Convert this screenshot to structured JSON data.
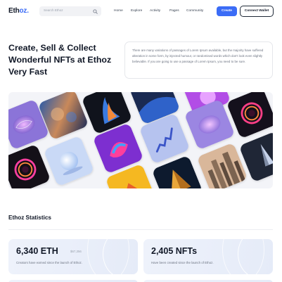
{
  "brand": {
    "name_main": "Eth",
    "name_accent": "oz."
  },
  "header": {
    "search_placeholder": "Search Ethoz",
    "nav": [
      "Home",
      "Explore",
      "Activity",
      "Pages",
      "Community"
    ],
    "create_label": "Create",
    "wallet_label": "Connect Wallet"
  },
  "hero": {
    "title": "Create, Sell & Collect Wonderful NFTs at Ethoz Very Fast",
    "description": "There are many variations of passages of Lorem Ipsum available, but the majority have suffered alteration in some form, by injected humour, or randomised words which don't look even slightly believable. If you are going to use a passage of Lorem Ipsum, you need to be sure."
  },
  "gallery": {
    "items": [
      "neon-ring",
      "cosmic-cloud",
      "blue-fire",
      "abstract-wave",
      "purple-orb",
      "brain-art",
      "neon-ring-2",
      "pastel-sphere",
      "swirl-shape",
      "spiral-ribbon",
      "golden-pyramid",
      "city-skyline",
      "dark-crystal",
      "brain-art-2",
      "gradient-abstract"
    ]
  },
  "stats": {
    "title": "Ethoz Statistics",
    "cards": [
      {
        "value": "6,340 ETH",
        "sub": "$67,356",
        "desc": "Creators have earned since the launch of Ethoz."
      },
      {
        "value": "2,405 NFTs",
        "sub": "",
        "desc": "Have been created since the launch of Ethoz."
      }
    ]
  },
  "colors": {
    "accent": "#3b6cf6",
    "text": "#111827",
    "muted": "#6b7280"
  }
}
